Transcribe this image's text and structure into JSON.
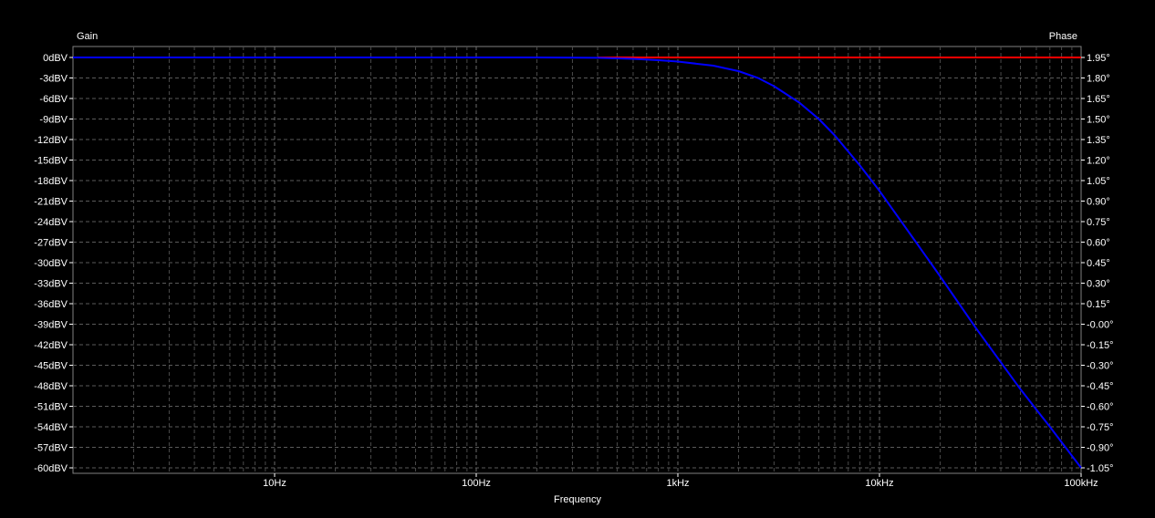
{
  "chart_data": {
    "type": "line",
    "xlabel": "Frequency",
    "y_left_label": "Gain",
    "y_right_label": "Phase",
    "x_scale": "log",
    "x_unit": "Hz",
    "xlim": [
      1,
      100000
    ],
    "x_ticks": [
      {
        "value": 10,
        "label": "10Hz"
      },
      {
        "value": 100,
        "label": "100Hz"
      },
      {
        "value": 1000,
        "label": "1kHz"
      },
      {
        "value": 10000,
        "label": "10kHz"
      },
      {
        "value": 100000,
        "label": "100kHz"
      }
    ],
    "y_left_unit": "dBV",
    "ylim_left": [
      -60,
      0
    ],
    "y_left_ticks": [
      "0dBV",
      "-3dBV",
      "-6dBV",
      "-9dBV",
      "-12dBV",
      "-15dBV",
      "-18dBV",
      "-21dBV",
      "-24dBV",
      "-27dBV",
      "-30dBV",
      "-33dBV",
      "-36dBV",
      "-39dBV",
      "-42dBV",
      "-45dBV",
      "-48dBV",
      "-51dBV",
      "-54dBV",
      "-57dBV",
      "-60dBV"
    ],
    "y_left_values": [
      0,
      -3,
      -6,
      -9,
      -12,
      -15,
      -18,
      -21,
      -24,
      -27,
      -30,
      -33,
      -36,
      -39,
      -42,
      -45,
      -48,
      -51,
      -54,
      -57,
      -60
    ],
    "ylim_right": [
      -1.05,
      1.95
    ],
    "y_right_ticks": [
      "1.95°",
      "1.80°",
      "1.65°",
      "1.50°",
      "1.35°",
      "1.20°",
      "1.05°",
      "0.90°",
      "0.75°",
      "0.60°",
      "0.45°",
      "0.30°",
      "0.15°",
      "-0.00°",
      "-0.15°",
      "-0.30°",
      "-0.45°",
      "-0.60°",
      "-0.75°",
      "-0.90°",
      "-1.05°"
    ],
    "grid": true,
    "series": [
      {
        "axis": "left",
        "color": "#0000ff",
        "x": [
          1,
          10,
          100,
          200,
          400,
          600,
          800,
          1000,
          1500,
          2000,
          2500,
          3000,
          4000,
          5000,
          6000,
          8000,
          10000,
          15000,
          20000,
          30000,
          50000,
          70000,
          100000
        ],
        "y": [
          0,
          0,
          0,
          0,
          -0.05,
          -0.2,
          -0.4,
          -0.6,
          -1.2,
          -2.0,
          -3.0,
          -4.2,
          -6.6,
          -9.0,
          -11.4,
          -15.8,
          -19.5,
          -26.8,
          -32.0,
          -39.5,
          -48.5,
          -54.0,
          -60.0
        ]
      },
      {
        "axis": "right",
        "color": "#ff0000",
        "x": [
          400,
          100000
        ],
        "y": [
          1.95,
          1.95
        ]
      }
    ]
  }
}
